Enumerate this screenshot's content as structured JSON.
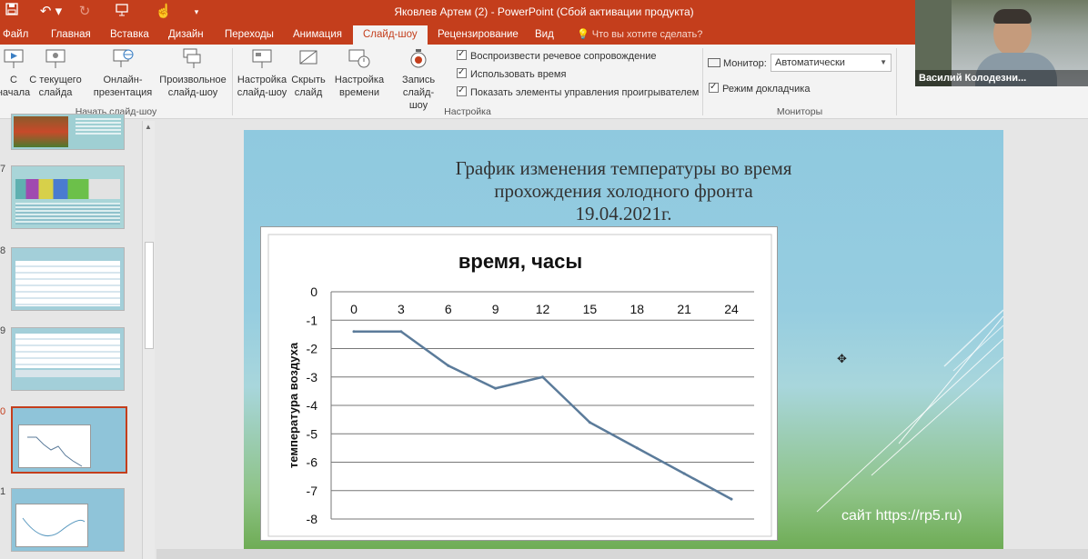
{
  "window": {
    "title": "Яковлев Артем (2) - PowerPoint (Сбой активации продукта)"
  },
  "quick_access": {
    "save_icon": "save-icon",
    "undo_icon": "undo-icon",
    "redo_icon": "redo-icon",
    "presenter_icon": "presenter-icon",
    "touch_icon": "touch-mode-icon"
  },
  "tabs": [
    {
      "label": "Файл"
    },
    {
      "label": "Главная"
    },
    {
      "label": "Вставка"
    },
    {
      "label": "Дизайн"
    },
    {
      "label": "Переходы"
    },
    {
      "label": "Анимация"
    },
    {
      "label": "Слайд-шоу"
    },
    {
      "label": "Рецензирование"
    },
    {
      "label": "Вид"
    }
  ],
  "tell_me": "Что вы хотите сделать?",
  "ribbon": {
    "start_group": {
      "label": "Начать слайд-шоу",
      "from_beginning": "С\nначала",
      "from_current": "С текущего\nслайда",
      "online": "Онлайн-\nпрезентация",
      "custom": "Произвольное\nслайд-шоу"
    },
    "setup_group": {
      "label": "Настройка",
      "setup_show": "Настройка\nслайд-шоу",
      "hide_slide": "Скрыть\nслайд",
      "rehearse": "Настройка\nвремени",
      "record": "Запись слайд-\nшоу",
      "chk_narration": "Воспроизвести речевое сопровождение",
      "chk_timings": "Использовать время",
      "chk_controls": "Показать элементы управления проигрывателем"
    },
    "monitors_group": {
      "label": "Мониторы",
      "monitor_label": "Монитор:",
      "monitor_value": "Автоматически",
      "presenter_view": "Режим докладчика"
    }
  },
  "thumbnails": [
    {
      "num": ""
    },
    {
      "num": "7"
    },
    {
      "num": "8"
    },
    {
      "num": "9"
    },
    {
      "num": "0"
    },
    {
      "num": "1"
    }
  ],
  "slide": {
    "title_line1": "График изменения температуры во время",
    "title_line2": "прохождения холодного фронта",
    "title_line3": "19.04.2021г.",
    "site": "сайт https://rp5.ru)"
  },
  "chart_data": {
    "type": "line",
    "title": "время, часы",
    "xlabel": "время, часы",
    "ylabel": "температура воздуха",
    "x": [
      0,
      3,
      6,
      9,
      12,
      15,
      18,
      21,
      24
    ],
    "x_ticks": [
      "0",
      "3",
      "6",
      "9",
      "12",
      "15",
      "18",
      "21",
      "24"
    ],
    "y_ticks": [
      "0",
      "-1",
      "-2",
      "-3",
      "-4",
      "-5",
      "-6",
      "-7",
      "-8"
    ],
    "series": [
      {
        "values": [
          -1.4,
          -1.4,
          -2.6,
          -3.4,
          -3.0,
          -4.6,
          -5.5,
          -6.4,
          -7.3
        ],
        "color": "#5b7b9a"
      }
    ],
    "ylim": [
      -8,
      0
    ],
    "xlim": [
      0,
      24
    ],
    "grid": true,
    "legend": "none"
  },
  "webcam": {
    "name": "Василий Колодезни..."
  }
}
